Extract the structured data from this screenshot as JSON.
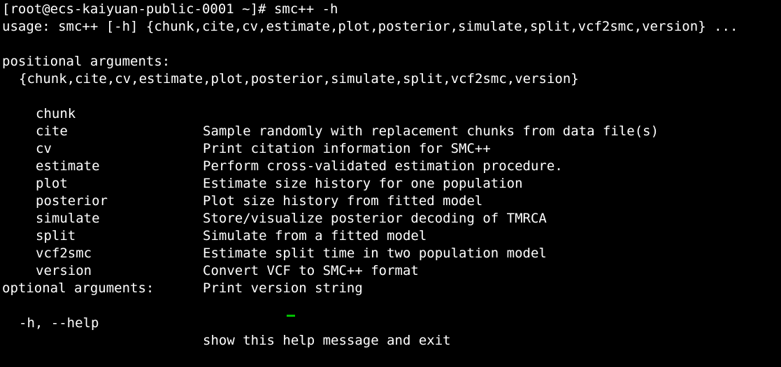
{
  "terminal": {
    "prompt": "[root@ecs-kaiyuan-public-0001 ~]# ",
    "command": "smc++ -h",
    "usage": "usage: smc++ [-h] {chunk,cite,cv,estimate,plot,posterior,simulate,split,vcf2smc,version} ...",
    "positional_header": "positional arguments:",
    "choices": "{chunk,cite,cv,estimate,plot,posterior,simulate,split,vcf2smc,version}",
    "subcommands": [
      {
        "name": "chunk",
        "desc": "Sample randomly with replacement chunks from data file(s)"
      },
      {
        "name": "cite",
        "desc": "Print citation information for SMC++"
      },
      {
        "name": "cv",
        "desc": "Perform cross-validated estimation procedure."
      },
      {
        "name": "estimate",
        "desc": "Estimate size history for one population"
      },
      {
        "name": "plot",
        "desc": "Plot size history from fitted model"
      },
      {
        "name": "posterior",
        "desc": "Store/visualize posterior decoding of TMRCA"
      },
      {
        "name": "simulate",
        "desc": "Simulate from a fitted model"
      },
      {
        "name": "split",
        "desc": "Estimate split time in two population model"
      },
      {
        "name": "vcf2smc",
        "desc": "Convert VCF to SMC++ format"
      },
      {
        "name": "version",
        "desc": "Print version string"
      }
    ],
    "optional_header": "optional arguments:",
    "optional": {
      "name": "-h, --help",
      "desc": "show this help message and exit"
    }
  },
  "colors": {
    "background": "#000000",
    "text": "#ffffff",
    "cursor": "#00c000"
  }
}
